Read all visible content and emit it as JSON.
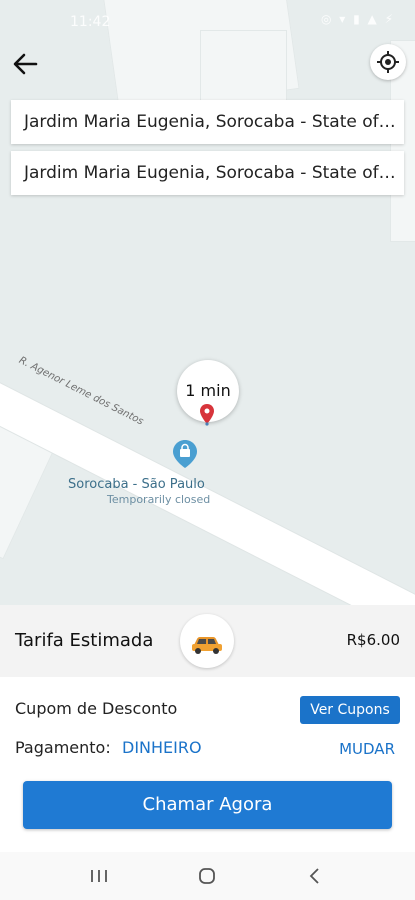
{
  "status_bar": {
    "time": "11:42",
    "icons": "◎ ▾ ▮ ▲ ⚡"
  },
  "header": {
    "back_icon": "arrow-left-icon",
    "locate_icon": "crosshair-icon"
  },
  "addresses": {
    "origin": "Jardim Maria Eugenia, Sorocaba - State of…",
    "destination": "Jardim Maria Eugenia, Sorocaba - State of…"
  },
  "map": {
    "street_name": "R. Agenor Leme dos Santos",
    "eta": "1 min",
    "poi_name": "Sorocaba - São Paulo",
    "poi_status": "Temporarily closed"
  },
  "fare": {
    "label": "Tarifa Estimada",
    "price": "R$6.00",
    "vehicle_icon": "car-icon"
  },
  "payment": {
    "coupon_label": "Cupom de Desconto",
    "coupon_button": "Ver Cupons",
    "payment_label": "Pagamento:",
    "payment_value": "DINHEIRO",
    "change_link": "MUDAR",
    "call_button": "Chamar Agora"
  },
  "nav": {
    "recent_icon": "recent-apps-icon",
    "home_icon": "home-icon",
    "back_icon": "back-icon"
  },
  "colors": {
    "accent": "#1f7ad3",
    "map_bg": "#e7eded"
  }
}
